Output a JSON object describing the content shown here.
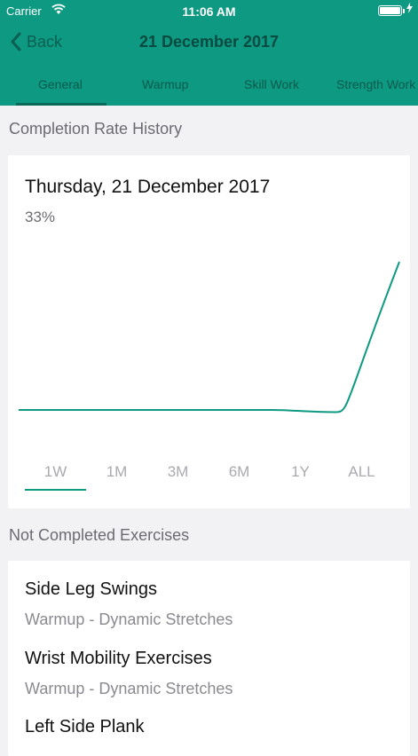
{
  "status": {
    "carrier": "Carrier",
    "time": "11:06 AM"
  },
  "nav": {
    "back_label": "Back",
    "title": "21 December 2017"
  },
  "tabs": [
    "General",
    "Warmup",
    "Skill Work",
    "Strength Work"
  ],
  "sections": {
    "history": "Completion Rate History",
    "not_completed": "Not Completed Exercises"
  },
  "chart": {
    "title": "Thursday, 21 December 2017",
    "value": "33%",
    "ranges": [
      "1W",
      "1M",
      "3M",
      "6M",
      "1Y",
      "ALL"
    ],
    "selected_range": "1W"
  },
  "exercises": [
    {
      "name": "Side Leg Swings",
      "category": "Warmup - Dynamic Stretches"
    },
    {
      "name": "Wrist Mobility Exercises",
      "category": "Warmup - Dynamic Stretches"
    },
    {
      "name": "Left Side Plank",
      "category": ""
    }
  ],
  "chart_data": {
    "type": "line",
    "title": "",
    "xlabel": "",
    "ylabel": "",
    "x": [
      0,
      1,
      2,
      3,
      4,
      5,
      6
    ],
    "values": [
      0,
      0,
      0,
      0,
      0,
      -0.5,
      33
    ],
    "ylim": [
      -1,
      33
    ],
    "grid": false,
    "color": "#0e9982"
  },
  "colors": {
    "accent": "#0e9982",
    "header": "#0e9982"
  }
}
